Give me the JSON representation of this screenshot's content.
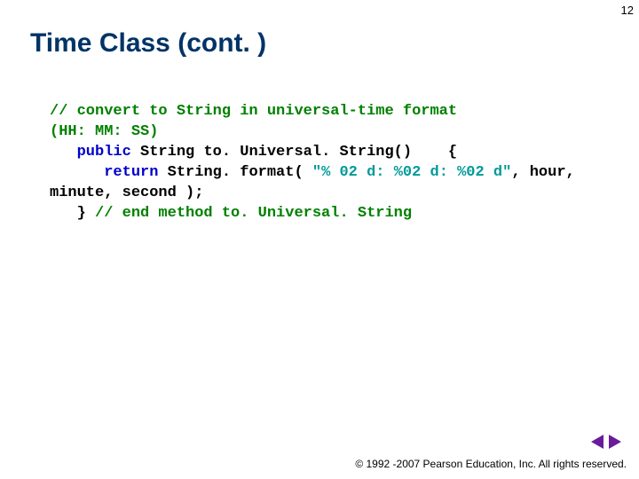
{
  "page_number": "12",
  "title": "Time Class (cont. )",
  "code": {
    "l1_comment": "// convert to String in universal-time format",
    "l2_comment": "(HH: MM: SS)",
    "l3_kw": "public",
    "l3_rest": " String to. Universal. String()    {",
    "l4a": "      ",
    "l4_kw": "return",
    "l4b": " String. format( ",
    "l4_str": "\"% 02 d: %02 d: %02 d\"",
    "l4c": ", hour,",
    "l5": "minute, second );",
    "l6a": "   } ",
    "l6_comment": "// end method to. Universal. String"
  },
  "footer": "© 1992 -2007 Pearson Education, Inc.  All rights reserved."
}
